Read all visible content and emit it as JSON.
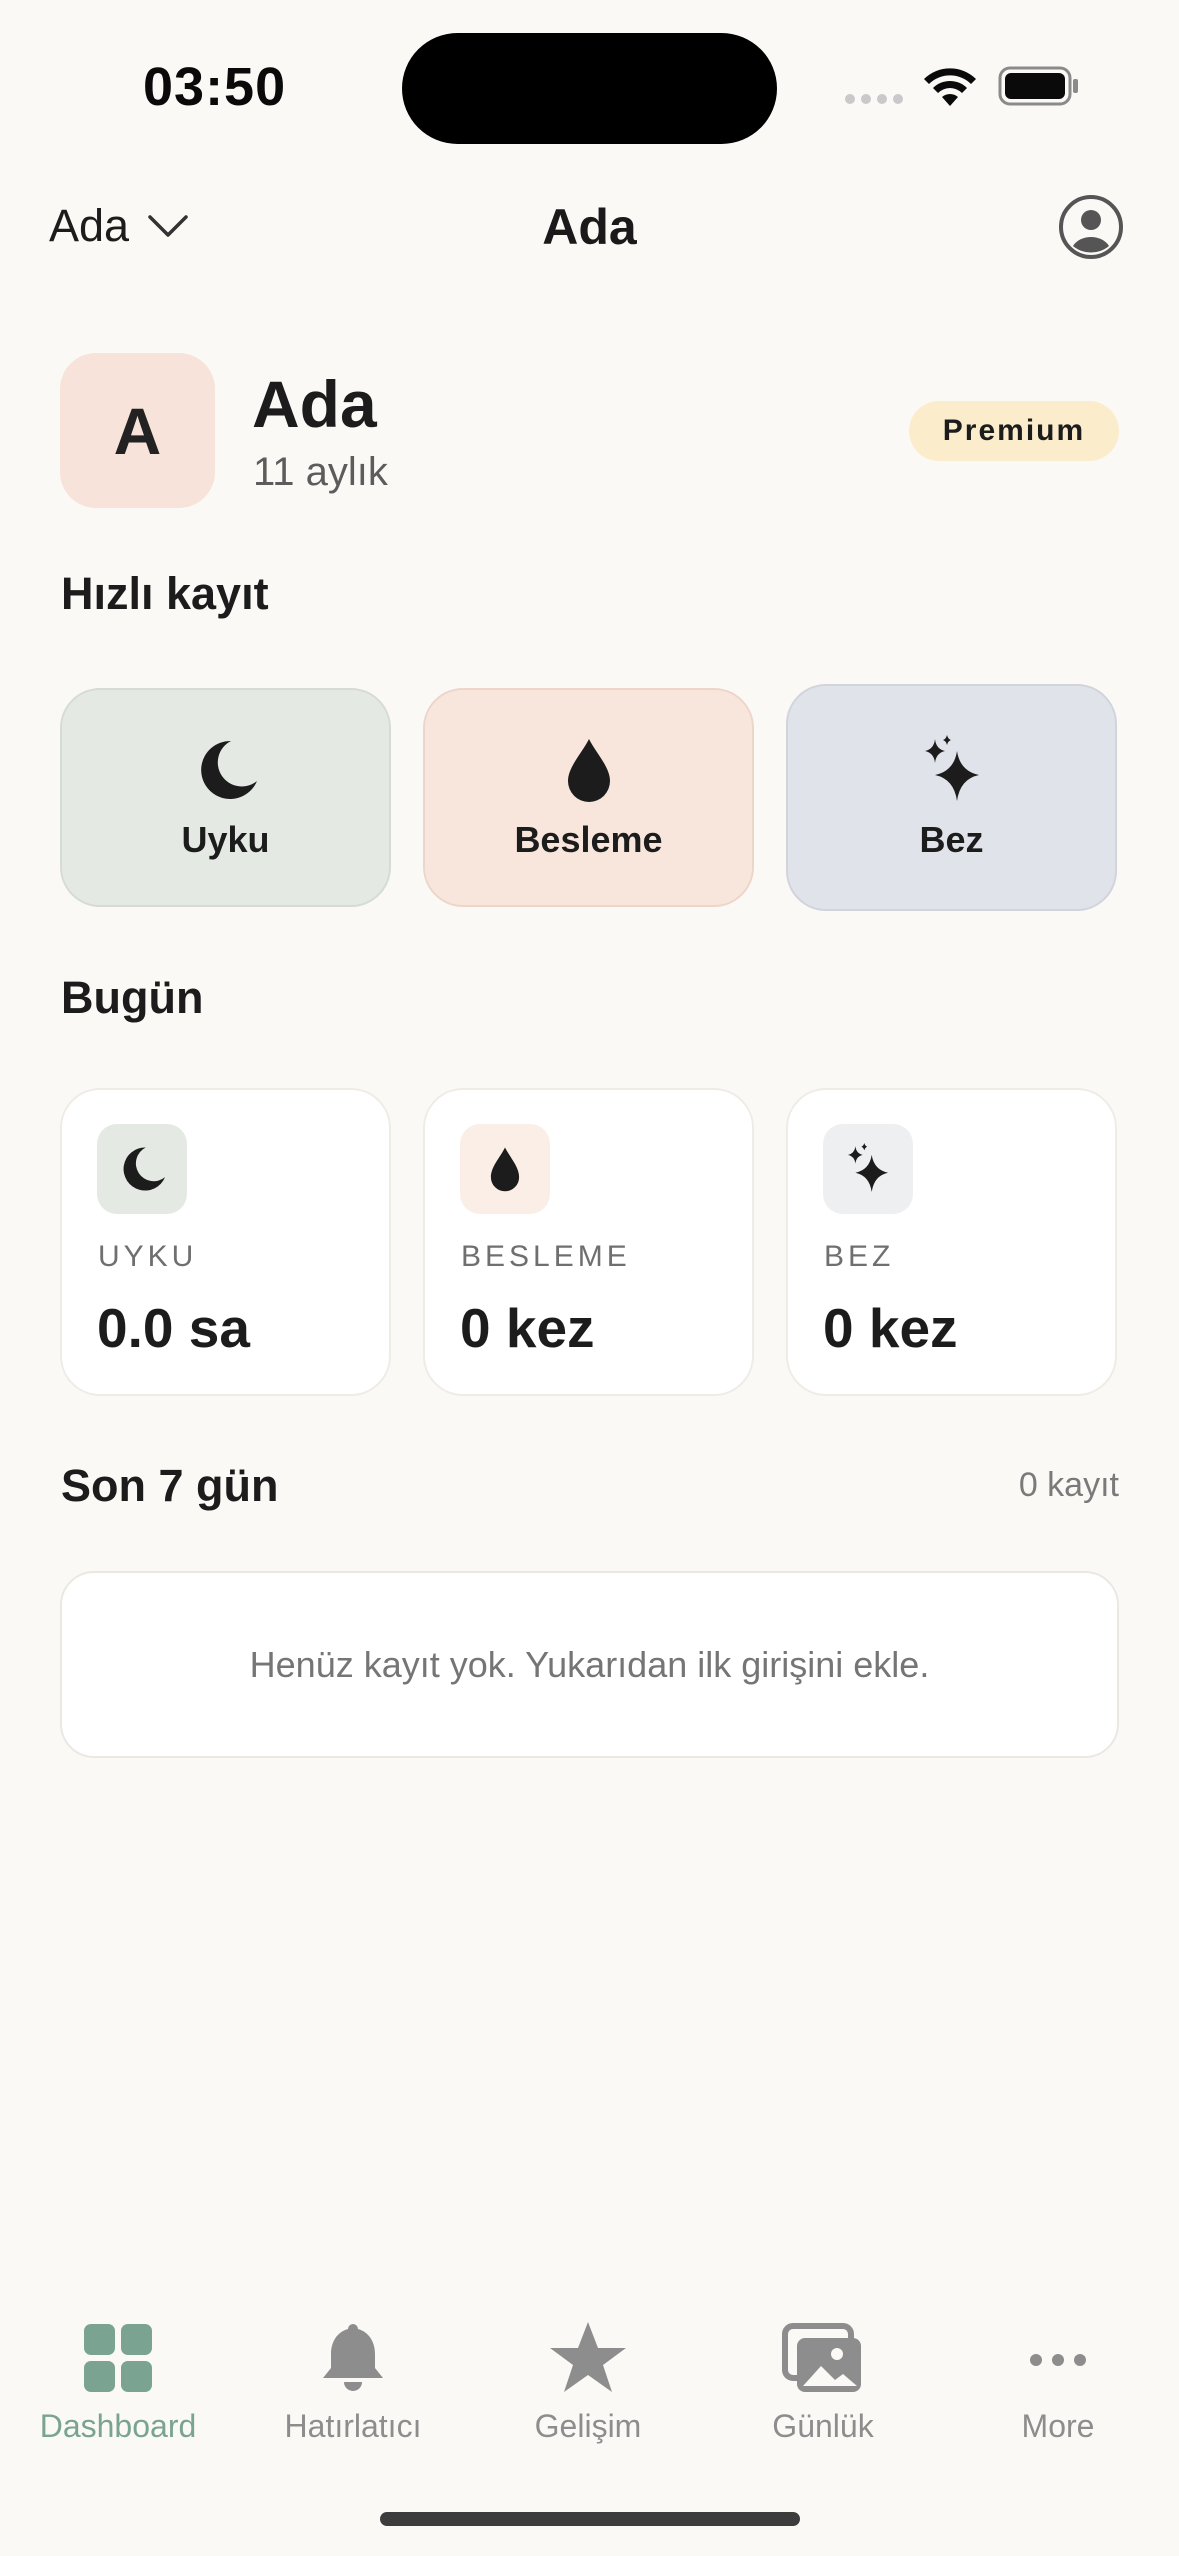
{
  "status_bar": {
    "time": "03:50"
  },
  "nav": {
    "child_selector": "Ada",
    "title": "Ada"
  },
  "child": {
    "initial": "A",
    "name": "Ada",
    "age": "11 aylık",
    "badge": "Premium"
  },
  "quick_log": {
    "title": "Hızlı kayıt",
    "buttons": [
      {
        "label": "Uyku",
        "icon": "moon-icon"
      },
      {
        "label": "Besleme",
        "icon": "drop-icon"
      },
      {
        "label": "Bez",
        "icon": "sparkles-icon"
      }
    ]
  },
  "today": {
    "title": "Bugün",
    "cards": [
      {
        "label": "UYKU",
        "value": "0.0 sa",
        "icon": "moon-icon"
      },
      {
        "label": "BESLEME",
        "value": "0 kez",
        "icon": "drop-icon"
      },
      {
        "label": "BEZ",
        "value": "0 kez",
        "icon": "sparkles-icon"
      }
    ]
  },
  "last7": {
    "title": "Son 7 gün",
    "count": "0 kayıt",
    "empty_message": "Henüz kayıt yok. Yukarıdan ilk girişini ekle."
  },
  "tabs": [
    {
      "label": "Dashboard",
      "icon": "grid-icon",
      "active": true
    },
    {
      "label": "Hatırlatıcı",
      "icon": "bell-icon",
      "active": false
    },
    {
      "label": "Gelişim",
      "icon": "star-icon",
      "active": false
    },
    {
      "label": "Günlük",
      "icon": "photos-icon",
      "active": false
    },
    {
      "label": "More",
      "icon": "more-icon",
      "active": false
    }
  ],
  "colors": {
    "background": "#fbf9f6",
    "accent": "#7aa392",
    "sleep_tint": "#e5e9e4",
    "feed_tint": "#f8e6dc",
    "diaper_tint": "#e1e3ea",
    "premium_tint": "#fbeccb"
  }
}
